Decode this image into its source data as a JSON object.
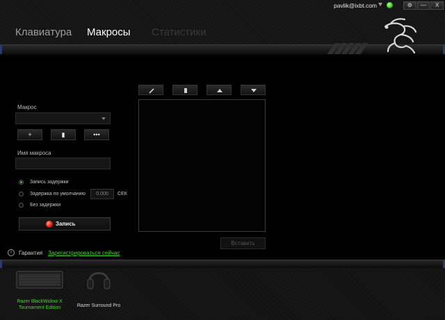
{
  "account": {
    "email": "pavlik@ixbt.com",
    "settings_label": "⚙",
    "minimize_label": "—",
    "close_label": "X"
  },
  "tabs": [
    {
      "label": "Клавиатура"
    },
    {
      "label": "Макросы"
    },
    {
      "label": "Статистики"
    }
  ],
  "macro": {
    "macro_label": "Макрос",
    "selected_macro": "",
    "add_label": "+",
    "delete_label": "▮",
    "more_label": "•••",
    "name_label": "Имя макроса",
    "name_value": "",
    "options": [
      {
        "label": "Запись задержки",
        "selected": true
      },
      {
        "label": "Задержка по умолчанию",
        "selected": false
      },
      {
        "label": "Без задержки",
        "selected": false
      }
    ],
    "default_delay_value": "0.000",
    "delay_unit": "СЕК",
    "record_label": "Запись"
  },
  "editor": {
    "toolbar_icons": [
      "edit-icon",
      "delete-icon",
      "move-up-icon",
      "move-down-icon"
    ],
    "insert_label": "Вставить"
  },
  "warranty": {
    "label": "Гарантия",
    "link_text": "Зарегистрироваться сейчас"
  },
  "devices": [
    {
      "name_line1": "Razer BlackWidow X",
      "name_line2": "Tournament Edition",
      "active": true
    },
    {
      "name_line1": "Razer Surround Pro",
      "name_line2": "",
      "active": false
    }
  ],
  "colors": {
    "accent": "#44d62c",
    "record": "#e01b0b",
    "background": "#000000"
  }
}
